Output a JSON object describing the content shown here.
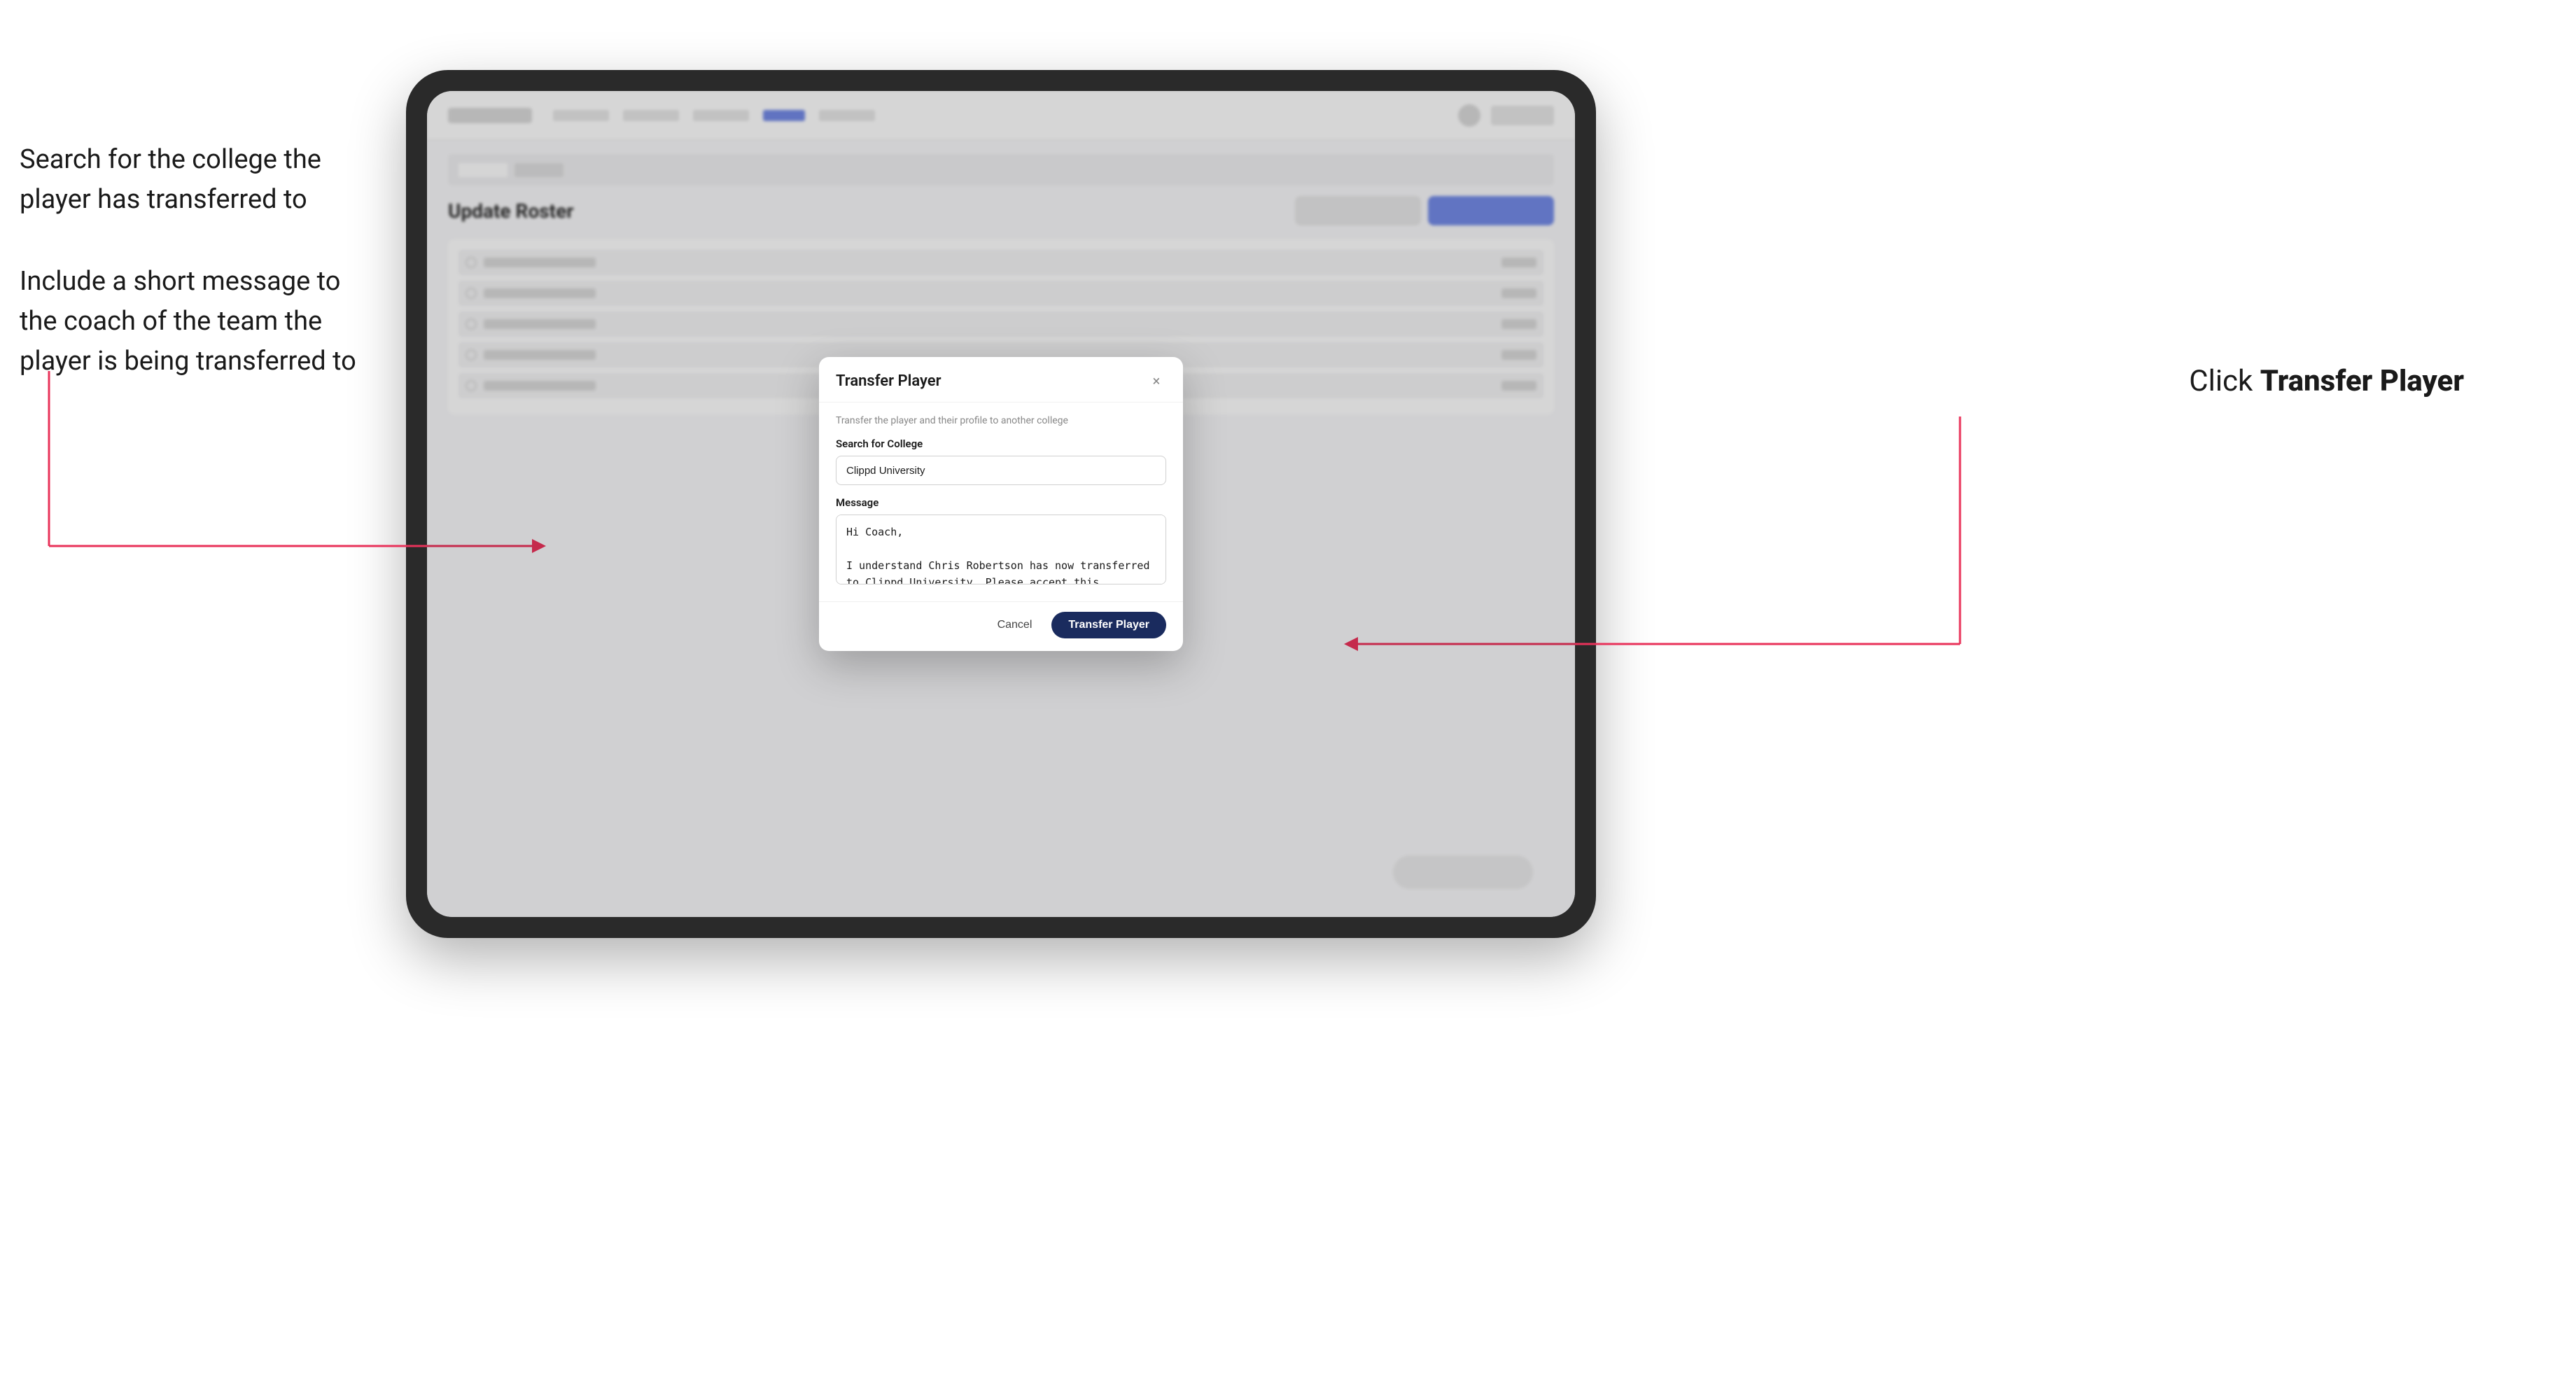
{
  "annotations": {
    "left_top": "Search for the college the player has transferred to",
    "left_bottom": "Include a short message to the coach of the team the player is being transferred to",
    "right": "Click ",
    "right_bold": "Transfer Player"
  },
  "modal": {
    "title": "Transfer Player",
    "subtitle": "Transfer the player and their profile to another college",
    "college_label": "Search for College",
    "college_value": "Clippd University",
    "message_label": "Message",
    "message_value": "Hi Coach,\n\nI understand Chris Robertson has now transferred to Clippd University. Please accept this transfer request when you can.",
    "cancel_label": "Cancel",
    "transfer_label": "Transfer Player",
    "close_icon": "×"
  },
  "app": {
    "roster_title": "Update Roster"
  }
}
